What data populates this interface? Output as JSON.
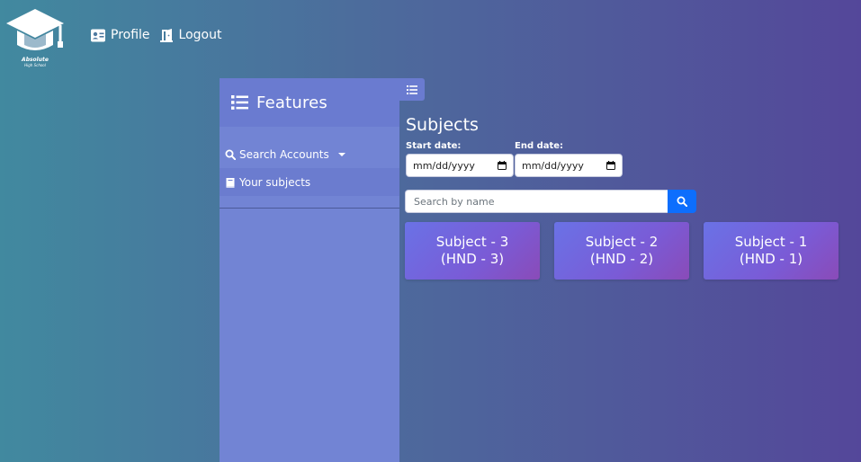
{
  "logo": {
    "title": "Absolute",
    "subtitle": "High School"
  },
  "topnav": {
    "profile_label": "Profile",
    "logout_label": "Logout"
  },
  "sidebar": {
    "title": "Features",
    "items": [
      {
        "label": "Search Accounts",
        "icon": "search-icon",
        "has_dropdown": true
      },
      {
        "label": "Your subjects",
        "icon": "book-icon",
        "active": true
      }
    ]
  },
  "main": {
    "title": "Subjects",
    "start_date": {
      "label": "Start date:",
      "value": "mm/dd/yyyy"
    },
    "end_date": {
      "label": "End date:",
      "value": "mm/dd/yyyy"
    },
    "search": {
      "placeholder": "Search by name"
    },
    "cards": [
      {
        "line1": "Subject - 3",
        "line2": "(HND - 3)"
      },
      {
        "line1": "Subject - 2",
        "line2": "(HND - 2)"
      },
      {
        "line1": "Subject - 1",
        "line2": "(HND - 1)"
      }
    ]
  },
  "colors": {
    "sidebar_bg": "#7284d4",
    "sidebar_header_bg": "#6a7bd0",
    "search_button": "#0d6efd",
    "background_start": "#41899f",
    "background_end": "#54479a"
  }
}
